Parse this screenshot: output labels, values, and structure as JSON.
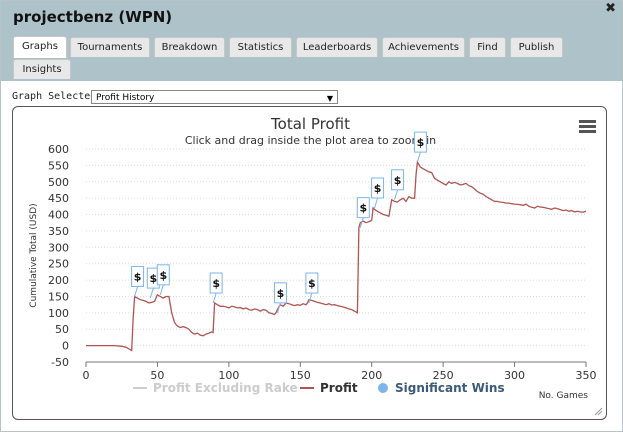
{
  "window": {
    "title": "projectbenz (WPN)",
    "close_icon": "✖"
  },
  "tabs": [
    {
      "label": "Graphs",
      "active": true
    },
    {
      "label": "Tournaments"
    },
    {
      "label": "Breakdown"
    },
    {
      "label": "Statistics"
    },
    {
      "label": "Leaderboards"
    },
    {
      "label": "Achievements"
    },
    {
      "label": "Find"
    },
    {
      "label": "Publish"
    },
    {
      "label": "Insights"
    }
  ],
  "graph_selector": {
    "label": "Graph Selected:",
    "value": "Profit History"
  },
  "chart_data": {
    "type": "line",
    "title": "Total Profit",
    "subtitle": "Click and drag inside the plot area to zoom-in",
    "xlabel": "No. Games",
    "ylabel": "Cumulative Total (USD)",
    "xlim": [
      0,
      350
    ],
    "ylim": [
      -50,
      600
    ],
    "xticks": [
      0,
      50,
      100,
      150,
      200,
      250,
      300,
      350
    ],
    "yticks": [
      -50,
      0,
      50,
      100,
      150,
      200,
      250,
      300,
      350,
      400,
      450,
      500,
      550,
      600
    ],
    "legend": [
      {
        "name": "Profit Excluding Rake",
        "color": "#cccccc"
      },
      {
        "name": "Profit",
        "color": "#b05454"
      },
      {
        "name": "Significant Wins",
        "color": "#7cb5ec"
      }
    ],
    "series": [
      {
        "name": "Profit",
        "color": "#b05454",
        "x": [
          0,
          5,
          10,
          15,
          20,
          25,
          28,
          30,
          32,
          33,
          34,
          36,
          38,
          40,
          42,
          44,
          46,
          48,
          50,
          52,
          54,
          56,
          58,
          60,
          62,
          64,
          66,
          68,
          70,
          72,
          74,
          76,
          78,
          80,
          82,
          84,
          86,
          87,
          88,
          89,
          90,
          92,
          94,
          96,
          98,
          100,
          102,
          104,
          106,
          108,
          110,
          112,
          114,
          116,
          118,
          120,
          122,
          124,
          126,
          128,
          130,
          132,
          133,
          134,
          136,
          138,
          140,
          142,
          144,
          146,
          148,
          150,
          152,
          154,
          155,
          156,
          158,
          160,
          162,
          164,
          166,
          168,
          170,
          172,
          174,
          176,
          178,
          180,
          182,
          184,
          186,
          188,
          190,
          191,
          192,
          194,
          196,
          198,
          200,
          201,
          202,
          204,
          206,
          208,
          210,
          212,
          214,
          216,
          218,
          220,
          222,
          224,
          226,
          228,
          230,
          231,
          232,
          234,
          236,
          238,
          240,
          242,
          244,
          246,
          248,
          250,
          252,
          254,
          256,
          258,
          260,
          262,
          264,
          266,
          268,
          270,
          272,
          274,
          276,
          278,
          280,
          282,
          284,
          286,
          288,
          290,
          292,
          294,
          296,
          298,
          300,
          302,
          304,
          306,
          308,
          310,
          312,
          314,
          316,
          318,
          320,
          322,
          324,
          326,
          328,
          330,
          332,
          334,
          336,
          338,
          340,
          342,
          344,
          346,
          348,
          350
        ],
        "y": [
          0,
          0,
          0,
          0,
          0,
          -2,
          -5,
          -10,
          -15,
          80,
          150,
          145,
          140,
          138,
          135,
          130,
          132,
          135,
          155,
          150,
          145,
          150,
          150,
          100,
          70,
          60,
          55,
          58,
          55,
          50,
          40,
          35,
          38,
          32,
          30,
          35,
          38,
          40,
          42,
          40,
          130,
          125,
          120,
          120,
          118,
          115,
          120,
          118,
          115,
          116,
          112,
          115,
          110,
          108,
          112,
          110,
          105,
          110,
          108,
          100,
          98,
          95,
          100,
          110,
          125,
          120,
          130,
          128,
          125,
          122,
          125,
          123,
          128,
          125,
          130,
          140,
          138,
          135,
          132,
          130,
          128,
          125,
          128,
          124,
          125,
          122,
          120,
          118,
          115,
          112,
          110,
          105,
          100,
          360,
          375,
          380,
          375,
          378,
          382,
          420,
          415,
          410,
          405,
          400,
          398,
          395,
          445,
          440,
          438,
          445,
          450,
          440,
          455,
          450,
          450,
          520,
          560,
          545,
          540,
          535,
          530,
          528,
          510,
          505,
          500,
          495,
          490,
          500,
          495,
          498,
          495,
          490,
          492,
          495,
          488,
          485,
          478,
          470,
          465,
          462,
          455,
          450,
          445,
          440,
          440,
          438,
          437,
          435,
          435,
          433,
          432,
          431,
          430,
          428,
          432,
          425,
          422,
          420,
          425,
          423,
          422,
          420,
          418,
          416,
          420,
          418,
          415,
          412,
          414,
          410,
          412,
          408,
          410,
          408,
          407,
          410
        ]
      }
    ],
    "significant_wins": [
      {
        "x": 34,
        "y": 150,
        "label": "$"
      },
      {
        "x": 45,
        "y": 145,
        "label": "$"
      },
      {
        "x": 52,
        "y": 155,
        "label": "$"
      },
      {
        "x": 89,
        "y": 130,
        "label": "$"
      },
      {
        "x": 134,
        "y": 100,
        "label": "$"
      },
      {
        "x": 156,
        "y": 130,
        "label": "$"
      },
      {
        "x": 192,
        "y": 360,
        "label": "$"
      },
      {
        "x": 202,
        "y": 420,
        "label": "$"
      },
      {
        "x": 216,
        "y": 445,
        "label": "$"
      },
      {
        "x": 232,
        "y": 560,
        "label": "$"
      }
    ]
  }
}
